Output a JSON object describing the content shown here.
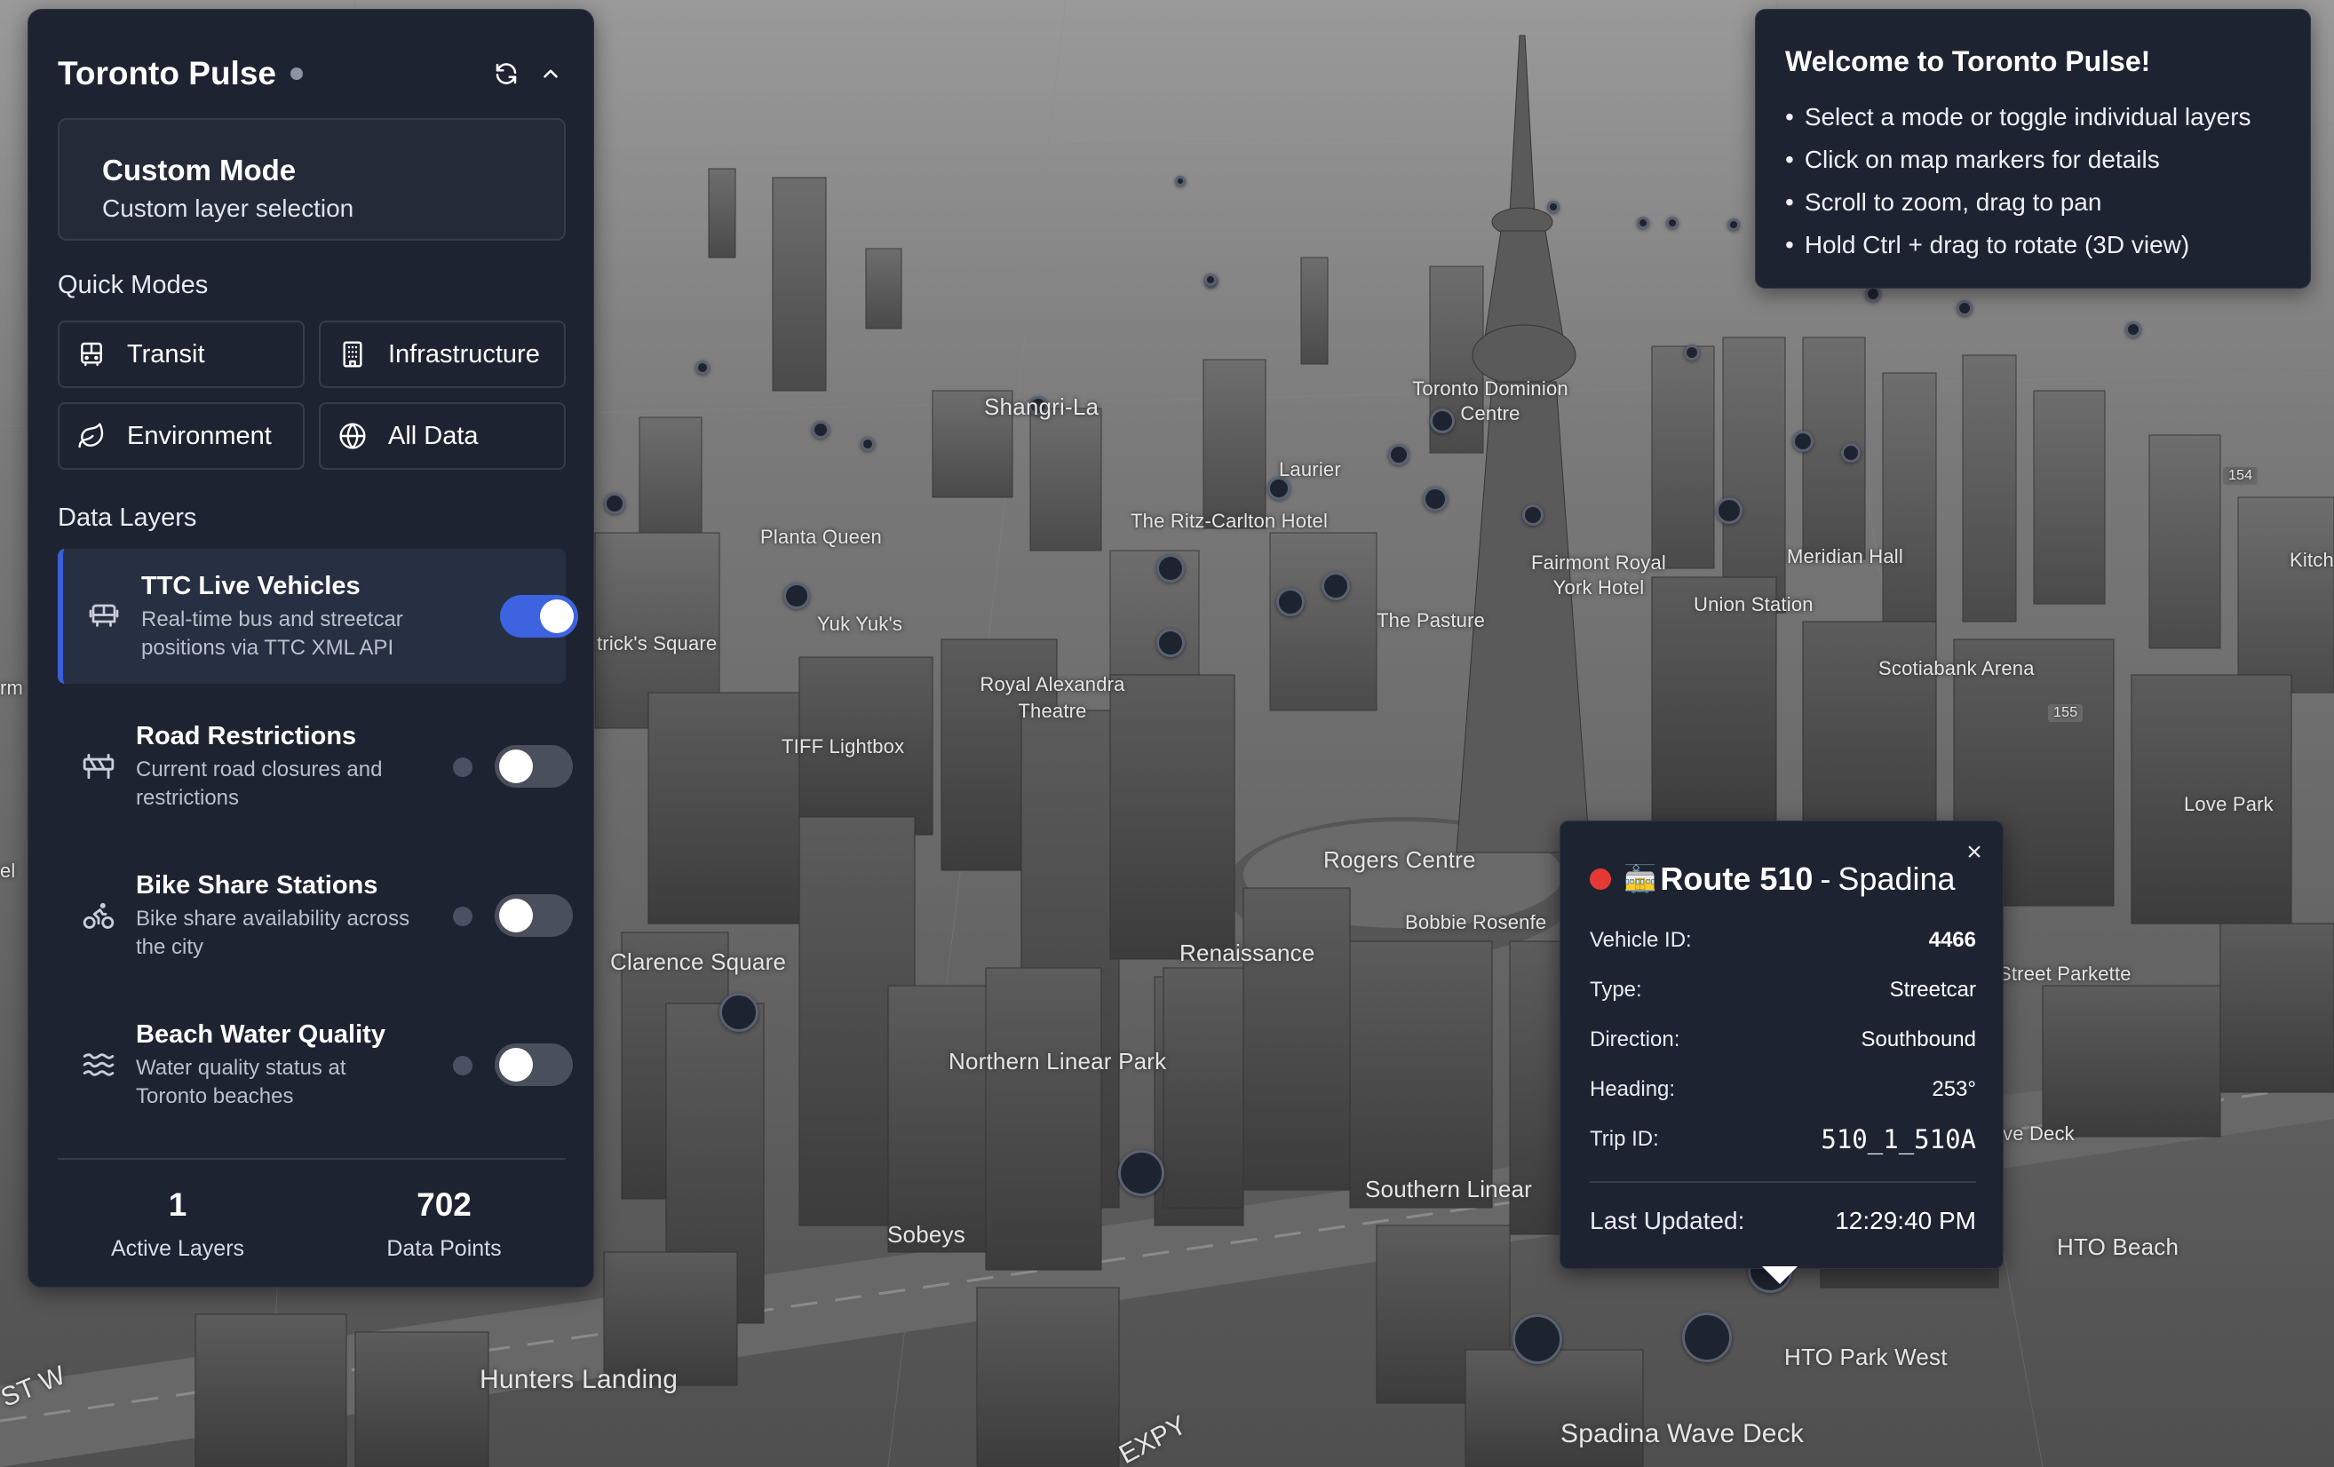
{
  "app": {
    "title": "Toronto Pulse"
  },
  "mode": {
    "title": "Custom Mode",
    "subtitle": "Custom layer selection"
  },
  "quick_modes": {
    "heading": "Quick Modes",
    "buttons": [
      {
        "label": "Transit",
        "icon": "bus-icon"
      },
      {
        "label": "Infrastructure",
        "icon": "building-icon"
      },
      {
        "label": "Environment",
        "icon": "leaf-icon"
      },
      {
        "label": "All Data",
        "icon": "globe-icon"
      }
    ]
  },
  "data_layers": {
    "heading": "Data Layers",
    "items": [
      {
        "title": "TTC Live Vehicles",
        "description": "Real-time bus and streetcar positions via TTC XML API",
        "enabled": true,
        "icon": "bus-icon"
      },
      {
        "title": "Road Restrictions",
        "description": "Current road closures and restrictions",
        "enabled": false,
        "icon": "road-barrier-icon"
      },
      {
        "title": "Bike Share Stations",
        "description": "Bike share availability across the city",
        "enabled": false,
        "icon": "bicycle-icon"
      },
      {
        "title": "Beach Water Quality",
        "description": "Water quality status at Toronto beaches",
        "enabled": false,
        "icon": "waves-icon"
      }
    ]
  },
  "stats": {
    "active_layers": "1",
    "active_layers_label": "Active Layers",
    "data_points": "702",
    "data_points_label": "Data Points"
  },
  "welcome": {
    "title": "Welcome to Toronto Pulse!",
    "tips": [
      "Select a mode or toggle individual layers",
      "Click on map markers for details",
      "Scroll to zoom, drag to pan",
      "Hold Ctrl + drag to rotate (3D view)"
    ]
  },
  "popup": {
    "route": "Route 510",
    "separator": "-",
    "route_name": "Spadina",
    "route_icon": "🚋",
    "close": "×",
    "rows": [
      {
        "label": "Vehicle ID:",
        "value": "4466"
      },
      {
        "label": "Type:",
        "value": "Streetcar"
      },
      {
        "label": "Direction:",
        "value": "Southbound"
      },
      {
        "label": "Heading:",
        "value": "253°"
      },
      {
        "label": "Trip ID:",
        "value": "510_1_510A"
      }
    ],
    "updated_label": "Last Updated:",
    "updated_value": "12:29:40 PM"
  },
  "map_labels": [
    "Shangri-La",
    "Toronto Dominion Centre",
    "Laurier",
    "Planta Queen",
    "The Ritz-Carlton Hotel",
    "Fairmont Royal York Hotel",
    "Meridian Hall",
    "Union Station",
    "The Pasture",
    "Yuk Yuk's",
    "trick's Square",
    "Royal Alexandra Theatre",
    "Scotiabank Arena",
    "TIFF Lightbox",
    "Rogers Centre",
    "Love Park",
    "Renaissance",
    "Bobbie Rosenfe",
    "Clarence Square",
    "Street Parkette",
    "Northern Linear Park",
    "ve Deck",
    "Southern Linear",
    "Sobeys",
    "HTO Beach",
    "HTO Park West",
    "Hunters Landing",
    "Spadina Wave Deck",
    "ST W",
    "EXPY",
    "Kitch",
    "154",
    "155",
    "el",
    "rm"
  ]
}
